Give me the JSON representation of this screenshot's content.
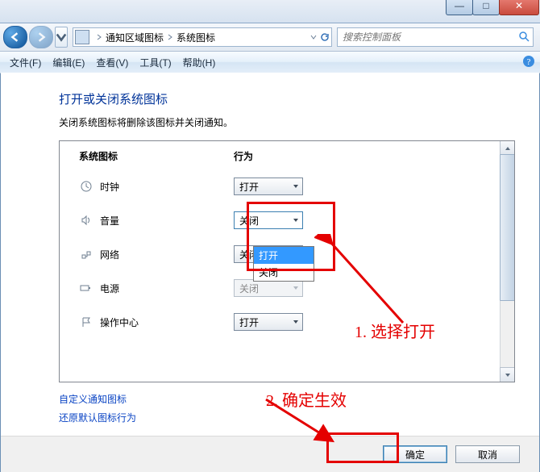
{
  "window": {
    "min": "—",
    "max": "□",
    "close": "✕"
  },
  "breadcrumb": {
    "item1": "通知区域图标",
    "item2": "系统图标"
  },
  "search": {
    "placeholder": "搜索控制面板"
  },
  "menu": {
    "file": "文件(F)",
    "edit": "编辑(E)",
    "view": "查看(V)",
    "tools": "工具(T)",
    "help": "帮助(H)"
  },
  "page": {
    "title": "打开或关闭系统图标",
    "desc": "关闭系统图标将删除该图标并关闭通知。"
  },
  "columns": {
    "c1": "系统图标",
    "c2": "行为"
  },
  "rows": {
    "clock": {
      "label": "时钟",
      "value": "打开"
    },
    "volume": {
      "label": "音量",
      "value": "关闭"
    },
    "network": {
      "label": "网络",
      "value": "关闭"
    },
    "power": {
      "label": "电源",
      "value": "关闭"
    },
    "action": {
      "label": "操作中心",
      "value": "打开"
    }
  },
  "dropdown": {
    "opt_open": "打开",
    "opt_close": "关闭"
  },
  "links": {
    "custom": "自定义通知图标",
    "restore": "还原默认图标行为"
  },
  "buttons": {
    "ok": "确定",
    "cancel": "取消"
  },
  "annotations": {
    "a1": "1. 选择打开",
    "a2": "2. 确定生效"
  }
}
